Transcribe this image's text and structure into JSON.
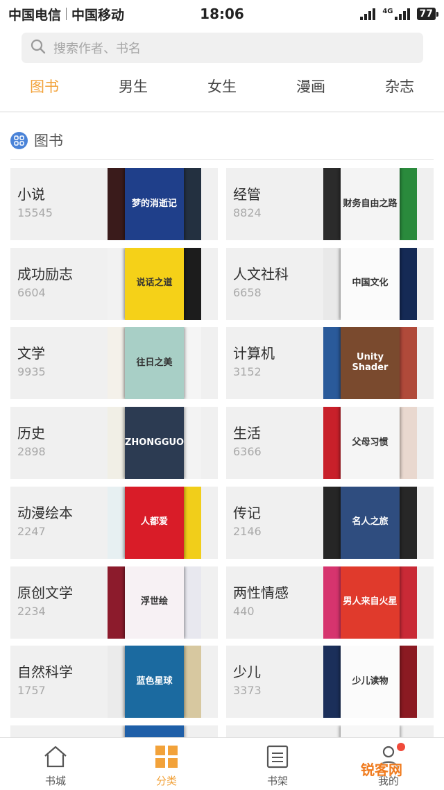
{
  "status": {
    "carrier1": "中国电信",
    "carrier2": "中国移动",
    "time": "18:06",
    "lte": "4G",
    "battery": "77"
  },
  "search": {
    "placeholder": "搜索作者、书名",
    "icon": "search-icon"
  },
  "tabs": [
    {
      "label": "图书",
      "active": true
    },
    {
      "label": "男生",
      "active": false
    },
    {
      "label": "女生",
      "active": false
    },
    {
      "label": "漫画",
      "active": false
    },
    {
      "label": "杂志",
      "active": false
    }
  ],
  "section": {
    "title": "图书",
    "icon": "grid-icon"
  },
  "categories": [
    {
      "name": "小说",
      "count": "15545",
      "covers": [
        "#3a1b1b",
        "#1f3f8a",
        "#233040"
      ],
      "cover_text": "梦的消逝记"
    },
    {
      "name": "经管",
      "count": "8824",
      "covers": [
        "#2b2b2b",
        "#f4f4f4",
        "#2a8a3c"
      ],
      "cover_text": "财务自由之路"
    },
    {
      "name": "成功励志",
      "count": "6604",
      "covers": [
        "#f2f2f2",
        "#f5d118",
        "#1c1c1c"
      ],
      "cover_text": "说话之道"
    },
    {
      "name": "人文社科",
      "count": "6658",
      "covers": [
        "#e9e9e9",
        "#fbfbfb",
        "#152a55"
      ],
      "cover_text": "中国文化"
    },
    {
      "name": "文学",
      "count": "9935",
      "covers": [
        "#f4f1ea",
        "#a8cfc6",
        "#f5f5f5"
      ],
      "cover_text": "往日之美"
    },
    {
      "name": "计算机",
      "count": "3152",
      "covers": [
        "#2a5a9a",
        "#7a4a2e",
        "#b04a3a"
      ],
      "cover_text": "Unity Shader"
    },
    {
      "name": "历史",
      "count": "2898",
      "covers": [
        "#f1efe6",
        "#2c3b52",
        "#f3f3f3"
      ],
      "cover_text": "ZHONGGUO"
    },
    {
      "name": "生活",
      "count": "6366",
      "covers": [
        "#c8202a",
        "#f5f5f5",
        "#e9d8cf"
      ],
      "cover_text": "父母习惯"
    },
    {
      "name": "动漫绘本",
      "count": "2247",
      "covers": [
        "#e7f0f2",
        "#d91c28",
        "#f1ce1a"
      ],
      "cover_text": "人都爱"
    },
    {
      "name": "传记",
      "count": "2146",
      "covers": [
        "#262626",
        "#2f4d7f",
        "#272727"
      ],
      "cover_text": "名人之旅"
    },
    {
      "name": "原创文学",
      "count": "2234",
      "covers": [
        "#8c1b2c",
        "#f7f1f4",
        "#e8e8ef"
      ],
      "cover_text": "浮世绘"
    },
    {
      "name": "两性情感",
      "count": "440",
      "covers": [
        "#d6346e",
        "#e03a2c",
        "#c92a36"
      ],
      "cover_text": "男人来自火星"
    },
    {
      "name": "自然科学",
      "count": "1757",
      "covers": [
        "#ebebeb",
        "#1b6aa0",
        "#d7c8a0"
      ],
      "cover_text": "蓝色星球"
    },
    {
      "name": "少儿",
      "count": "3373",
      "covers": [
        "#1b2f5a",
        "#fbfbfb",
        "#8b1a22"
      ],
      "cover_text": "少儿读物"
    }
  ],
  "tabbar": [
    {
      "label": "书城",
      "icon": "home-icon",
      "active": false
    },
    {
      "label": "分类",
      "icon": "category-grid-icon",
      "active": true
    },
    {
      "label": "书架",
      "icon": "bookshelf-icon",
      "active": false
    },
    {
      "label": "我的",
      "icon": "user-icon",
      "active": false
    }
  ],
  "watermark": {
    "text": "锐客网"
  },
  "colors": {
    "accent": "#f2a23a",
    "card_bg": "#f0f0f0",
    "section_icon": "#4a83d8",
    "badge": "#f04a3a"
  }
}
